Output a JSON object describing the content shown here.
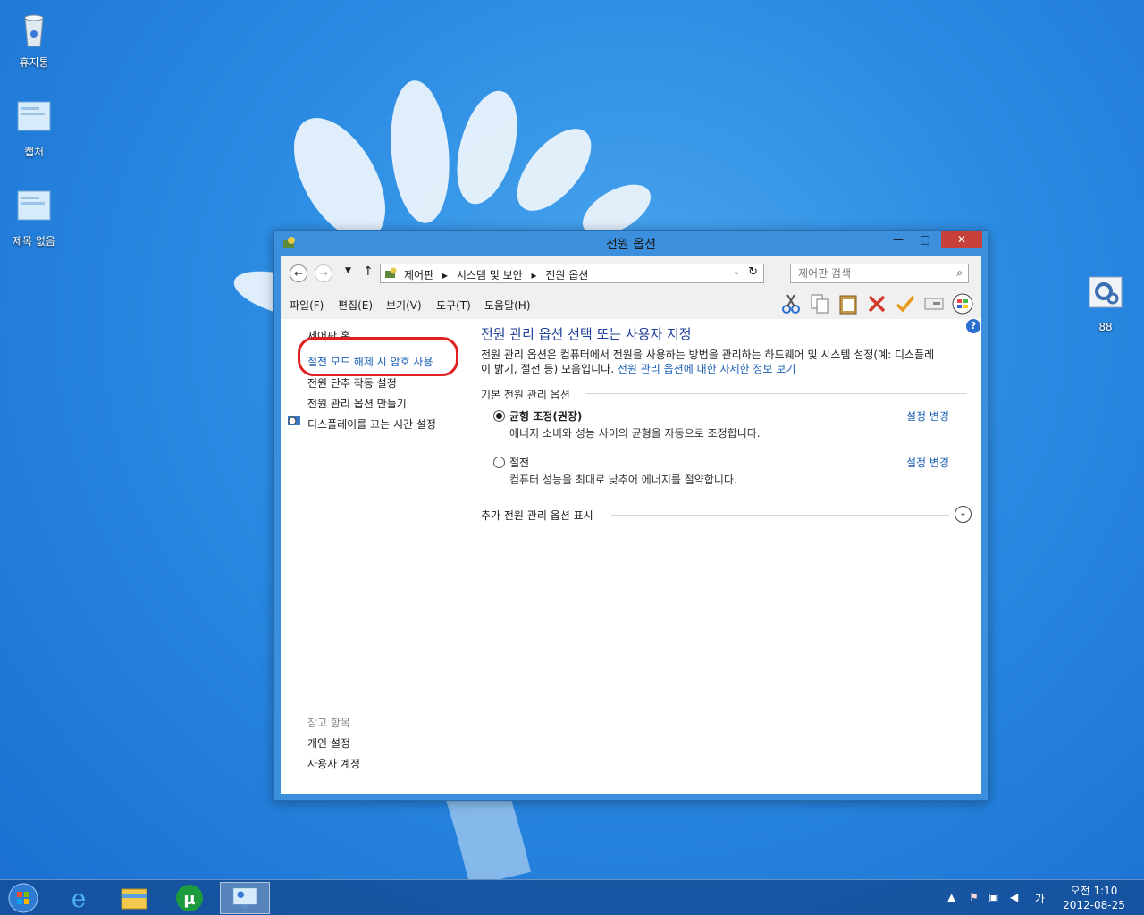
{
  "desktop": {
    "icons": [
      {
        "label": "휴지통"
      },
      {
        "label": "캡처"
      },
      {
        "label": "제목 없음"
      },
      {
        "label": "88"
      }
    ]
  },
  "window": {
    "title": "전원 옵션",
    "minimize": "—",
    "maximize": "□",
    "close": "✕"
  },
  "address": {
    "parts": [
      "제어판",
      "▸",
      "시스템 및 보안",
      "▸",
      "전원 옵션"
    ],
    "search_placeholder": "제어판 검색"
  },
  "menu": [
    "파일(F)",
    "편집(E)",
    "보기(V)",
    "도구(T)",
    "도움말(H)"
  ],
  "sidebar": {
    "home": "제어판 홈",
    "items": [
      "절전 모드 해제 시 암호 사용",
      "전원 단추 작동 설정",
      "전원 관리 옵션 만들기",
      "디스플레이를 끄는 시간 설정"
    ],
    "see_also_title": "참고 항목",
    "see_also": [
      "개인 설정",
      "사용자 계정"
    ]
  },
  "main": {
    "title": "전원 관리 옵션 선택 또는 사용자 지정",
    "desc_line1": "전원 관리 옵션은 컴퓨터에서 전원을 사용하는 방법을 관리하는 하드웨어 및 시스템 설정(예: 디스플레",
    "desc_line2": "이 밝기, 절전 등) 모음입니다.",
    "desc_link": "전원 관리 옵션에 대한 자세한 정보 보기",
    "section_title": "기본 전원 관리 옵션",
    "plans": [
      {
        "name": "균형 조정(권장)",
        "desc": "에너지 소비와 성능 사이의 균형을 자동으로 조정합니다.",
        "change": "설정 변경",
        "selected": true
      },
      {
        "name": "절전",
        "desc": "컴퓨터 성능을 최대로 낮추어 에너지를 절약합니다.",
        "change": "설정 변경",
        "selected": false
      }
    ],
    "more_label": "추가 전원 관리 옵션 표시",
    "help": "?"
  },
  "taskbar": {
    "ime": "가",
    "time": "오전 1:10",
    "date": "2012-08-25"
  }
}
